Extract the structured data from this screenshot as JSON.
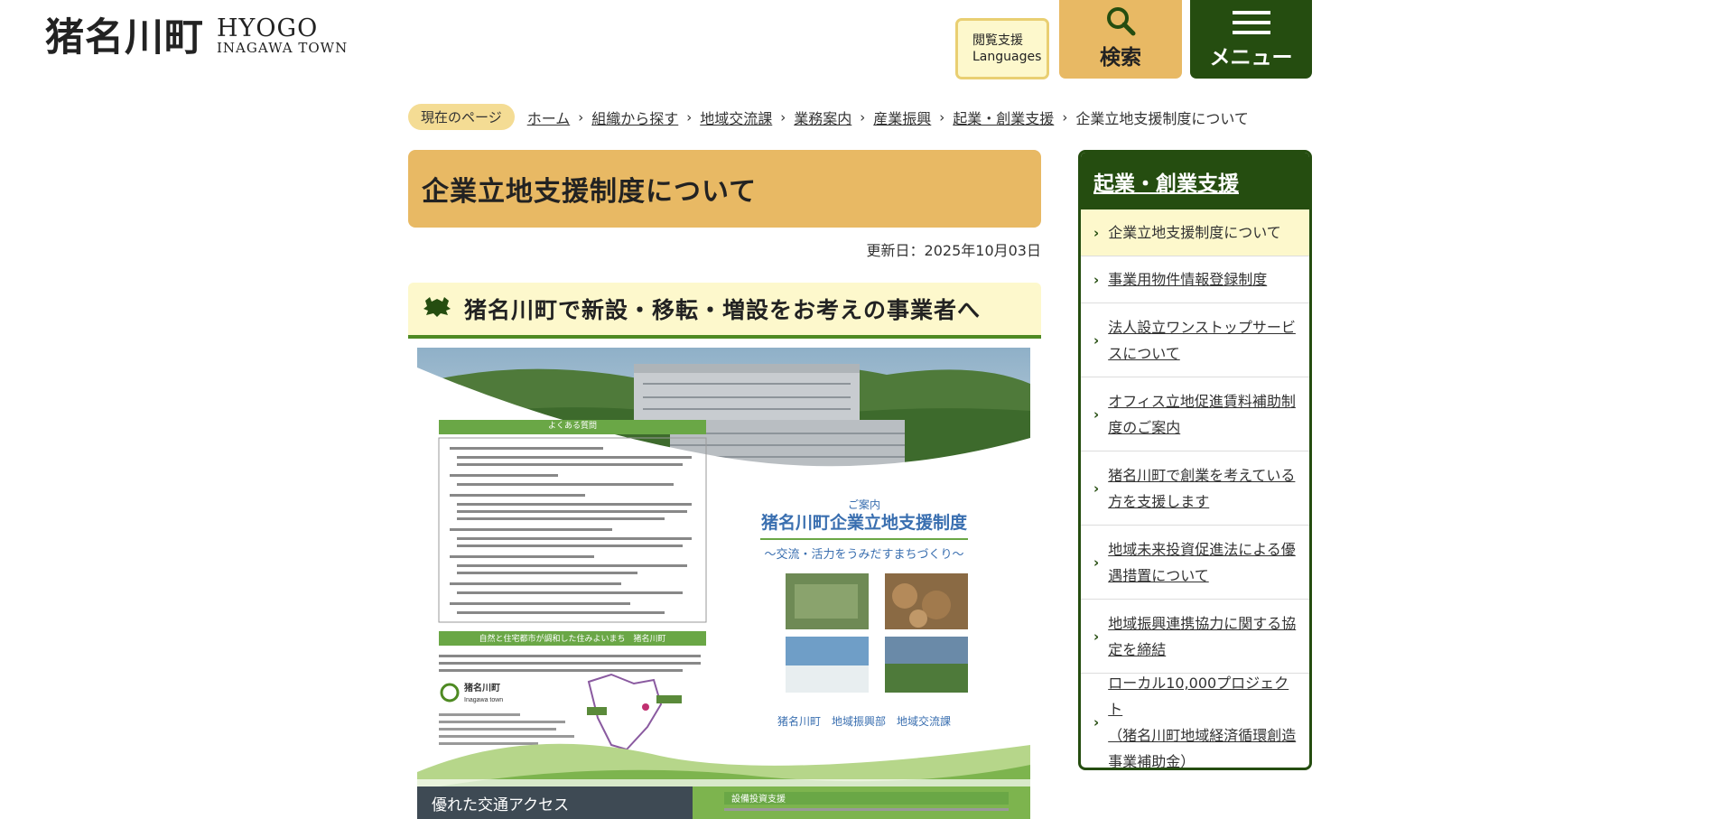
{
  "header": {
    "logo_kanji": "猪名川町",
    "logo_latin_1": "HYOGO",
    "logo_latin_2": "INAGAWA TOWN",
    "lang_btn_line1": "閲覧支援",
    "lang_btn_line2": "Languages",
    "search_label": "検索",
    "menu_label": "メニュー"
  },
  "breadcrumb": {
    "current_label": "現在のページ",
    "items": [
      "ホーム",
      "組織から探す",
      "地域交流課",
      "業務案内",
      "産業振興",
      "起業・創業支援"
    ],
    "current": "企業立地支援制度について"
  },
  "main": {
    "title": "企業立地支援制度について",
    "updated": "更新日：2025年10月03日",
    "section_title": "猪名川町で新設・移転・増設をお考えの事業者へ"
  },
  "flyer": {
    "faq_heading": "よくある質問",
    "info_small": "ご案内",
    "info_title": "猪名川町企業立地支援制度",
    "info_sub": "～交流・活力をうみだすまちづくり～",
    "slogan": "自然と住宅都市が調和した住みよいまち　猪名川町",
    "town_name": "猪名川町",
    "town_latin": "Inagawa town",
    "dept": "猪名川町　地域振興部　地域交流課",
    "bottom_left": "優れた交通アクセス",
    "bottom_right": "設備投資支援"
  },
  "sidenav": {
    "title": "起業・創業支援",
    "items": [
      {
        "line1": "企業立地支援制度について",
        "line2": "",
        "line3": ""
      },
      {
        "line1": "事業用物件情報登録制度",
        "line2": "",
        "line3": ""
      },
      {
        "line1": "法人設立ワンストップサービ",
        "line2": "スについて",
        "line3": ""
      },
      {
        "line1": "オフィス立地促進賃料補助制",
        "line2": "度のご案内",
        "line3": ""
      },
      {
        "line1": "猪名川町で創業を考えている",
        "line2": "方を支援します",
        "line3": ""
      },
      {
        "line1": "地域未来投資促進法による優",
        "line2": "遇措置について",
        "line3": ""
      },
      {
        "line1": "地域振興連携協力に関する協",
        "line2": "定を締結",
        "line3": ""
      },
      {
        "line1": "ローカル10,000プロジェクト",
        "line2": "（猪名川町地域経済循環創造",
        "line3": "事業補助金）"
      }
    ]
  },
  "colors": {
    "accent_orange": "#e8b964",
    "dark_green": "#254d10",
    "light_yellow": "#fdf8cc",
    "mid_green": "#4e8a22"
  }
}
